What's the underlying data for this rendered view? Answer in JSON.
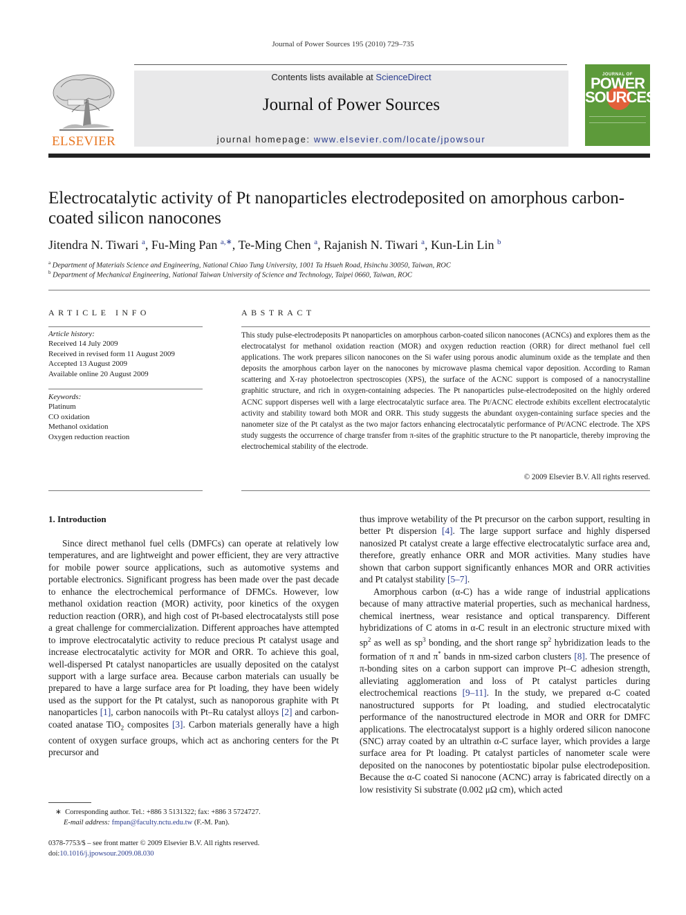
{
  "running_head": "Journal of Power Sources 195 (2010) 729–735",
  "banner": {
    "contents_prefix": "Contents lists available at ",
    "contents_link": "ScienceDirect",
    "journal_title": "Journal of Power Sources",
    "homepage_prefix": "journal homepage: ",
    "homepage_link": "www.elsevier.com/locate/jpowsour"
  },
  "publisher_logo": {
    "text": "ELSEVIER",
    "color": "#e87722"
  },
  "cover": {
    "line1": "JOURNAL OF",
    "line2": "POWER",
    "line3": "SOURCES",
    "color": "#5d9a3a"
  },
  "article": {
    "title": "Electrocatalytic activity of Pt nanoparticles electrodeposited on amorphous carbon-coated silicon nanocones",
    "authors": [
      {
        "name": "Jitendra N. Tiwari",
        "sup": "a"
      },
      {
        "name": "Fu-Ming Pan",
        "sup": "a,∗"
      },
      {
        "name": "Te-Ming Chen",
        "sup": "a"
      },
      {
        "name": "Rajanish N. Tiwari",
        "sup": "a"
      },
      {
        "name": "Kun-Lin Lin",
        "sup": "b"
      }
    ],
    "affiliations": [
      {
        "sup": "a",
        "text": "Department of Materials Science and Engineering, National Chiao Tung University, 1001 Ta Hsueh Road, Hsinchu 30050, Taiwan, ROC"
      },
      {
        "sup": "b",
        "text": "Department of Mechanical Engineering, National Taiwan University of Science and Technology, Taipei 0660, Taiwan, ROC"
      }
    ]
  },
  "article_info": {
    "heading": "ARTICLE INFO",
    "history_label": "Article history:",
    "history": [
      "Received 14 July 2009",
      "Received in revised form 11 August 2009",
      "Accepted 13 August 2009",
      "Available online 20 August 2009"
    ],
    "keywords_label": "Keywords:",
    "keywords": [
      "Platinum",
      "CO oxidation",
      "Methanol oxidation",
      "Oxygen reduction reaction"
    ]
  },
  "abstract": {
    "heading": "ABSTRACT",
    "text": "This study pulse-electrodeposits Pt nanoparticles on amorphous carbon-coated silicon nanocones (ACNCs) and explores them as the electrocatalyst for methanol oxidation reaction (MOR) and oxygen reduction reaction (ORR) for direct methanol fuel cell applications. The work prepares silicon nanocones on the Si wafer using porous anodic aluminum oxide as the template and then deposits the amorphous carbon layer on the nanocones by microwave plasma chemical vapor deposition. According to Raman scattering and X-ray photoelectron spectroscopies (XPS), the surface of the ACNC support is composed of a nanocrystalline graphitic structure, and rich in oxygen-containing adspecies. The Pt nanoparticles pulse-electrodeposited on the highly ordered ACNC support disperses well with a large electrocatalytic surface area. The Pt/ACNC electrode exhibits excellent electrocatalytic activity and stability toward both MOR and ORR. This study suggests the abundant oxygen-containing surface species and the nanometer size of the Pt catalyst as the two major factors enhancing electrocatalytic performance of Pt/ACNC electrode. The XPS study suggests the occurrence of charge transfer from π-sites of the graphitic structure to the Pt nanoparticle, thereby improving the electrochemical stability of the electrode.",
    "copyright": "© 2009 Elsevier B.V. All rights reserved."
  },
  "introduction": {
    "heading": "1.  Introduction",
    "left": {
      "p1": "Since direct methanol fuel cells (DMFCs) can operate at relatively low temperatures, and are lightweight and power efficient, they are very attractive for mobile power source applications, such as automotive systems and portable electronics. Significant progress has been made over the past decade to enhance the electrochemical performance of DFMCs. However, low methanol oxidation reaction (MOR) activity, poor kinetics of the oxygen reduction reaction (ORR), and high cost of Pt-based electrocatalysts still pose a great challenge for commercialization. Different approaches have attempted to improve electrocatalytic activity to reduce precious Pt catalyst usage and increase electrocatalytic activity for MOR and ORR. To achieve this goal, well-dispersed Pt catalyst nanoparticles are usually deposited on the catalyst support with a large surface area. Because carbon materials can usually be prepared to have a large surface area for Pt loading, they have been widely used as the support for the Pt catalyst, such as nanoporous graphite with Pt nanoparticles ",
      "ref1": "[1]",
      "t2": ", carbon nanocoils with Pt–Ru catalyst alloys ",
      "ref2": "[2]",
      "t3": " and carbon-coated anatase TiO",
      "sub3": "2",
      "t4": " composites ",
      "ref3": "[3]",
      "t5": ". Carbon materials generally have a high content of oxygen surface groups, which act as anchoring centers for the Pt precursor and"
    },
    "right": {
      "a1": "thus improve wetability of the Pt precursor on the carbon support, resulting in better Pt dispersion ",
      "ref4": "[4]",
      "a2": ". The large support surface and highly dispersed nanosized Pt catalyst create a large effective electrocatalytic surface area and, therefore, greatly enhance ORR and MOR activities. Many studies have shown that carbon support significantly enhances MOR and ORR activities and Pt catalyst stability ",
      "ref57": "[5–7]",
      "a3": ".",
      "b1": "Amorphous carbon (α-C) has a wide range of industrial applications because of many attractive material properties, such as mechanical hardness, chemical inertness, wear resistance and optical transparency. Different hybridizations of C atoms in α-C result in an electronic structure mixed with sp",
      "sup2a": "2",
      "b2": " as well as sp",
      "sup3": "3",
      "b3": " bonding, and the short range sp",
      "sup2b": "2",
      "b4": " hybridization leads to the formation of π and π",
      "star": "*",
      "b5": " bands in nm-sized carbon clusters ",
      "ref8": "[8]",
      "b6": ". The presence of π-bonding sites on a carbon support can improve Pt–C adhesion strength, alleviating agglomeration and loss of Pt catalyst particles during electrochemical reactions ",
      "ref911": "[9–11]",
      "b7": ". In the study, we prepared α-C coated nanostructured supports for Pt loading, and studied electrocatalytic performance of the nanostructured electrode in MOR and ORR for DMFC applications. The electrocatalyst support is a highly ordered silicon nanocone (SNC) array coated by an ultrathin α-C surface layer, which provides a large surface area for Pt loading. Pt catalyst particles of nanometer scale were deposited on the nanocones by potentiostatic bipolar pulse electrodeposition. Because the α-C coated Si nanocone (ACNC) array is fabricated directly on a low resistivity Si substrate (0.002 μΩ cm), which acted"
    }
  },
  "footnotes": {
    "star": "∗",
    "corresponding": "Corresponding author. Tel.: +886 3 5131322; fax: +886 3 5724727.",
    "email_label": "E-mail address:",
    "email": "fmpan@faculty.nctu.edu.tw",
    "email_suffix": " (F.-M. Pan).",
    "issn": "0378-7753/$ – see front matter © 2009 Elsevier B.V. All rights reserved.",
    "doi_prefix": "doi:",
    "doi": "10.1016/j.jpowsour.2009.08.030"
  }
}
